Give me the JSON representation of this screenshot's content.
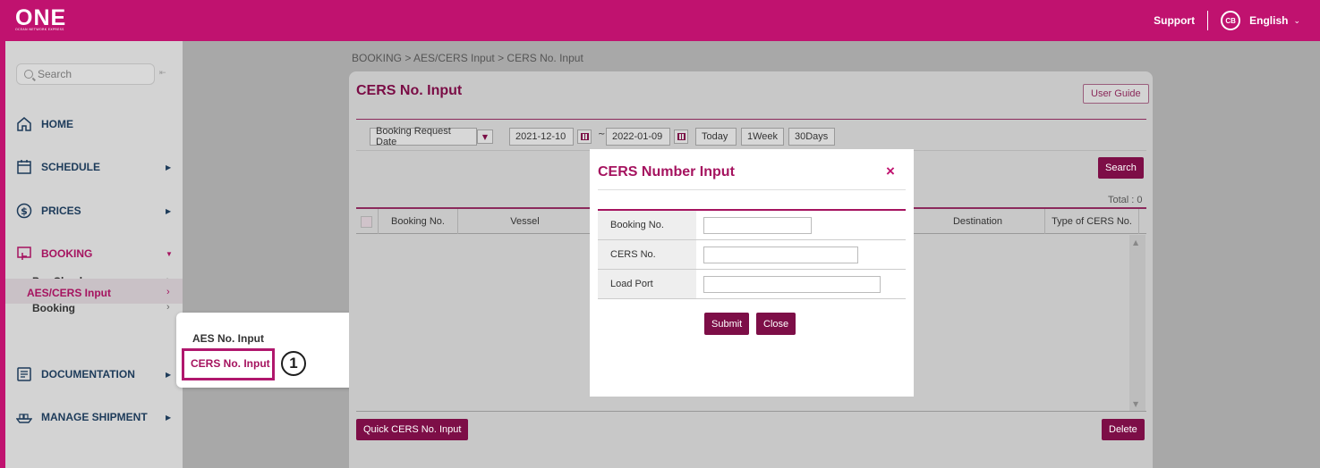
{
  "header": {
    "logo_text": "ONE",
    "logo_subtext": "OCEAN NETWORK EXPRESS",
    "support_label": "Support",
    "avatar_initials": "CB",
    "language_label": "English"
  },
  "sidebar": {
    "search_placeholder": "Search",
    "items": [
      {
        "label": "HOME",
        "icon": "home-icon"
      },
      {
        "label": "SCHEDULE",
        "icon": "calendar-icon"
      },
      {
        "label": "PRICES",
        "icon": "dollar-icon"
      },
      {
        "label": "BOOKING",
        "icon": "booking-icon"
      },
      {
        "label": "DOCUMENTATION",
        "icon": "document-icon"
      },
      {
        "label": "MANAGE SHIPMENT",
        "icon": "ship-icon"
      }
    ],
    "booking_sub": [
      {
        "label": "Pre-Check"
      },
      {
        "label": "Booking"
      },
      {
        "label": "AES/CERS Input"
      }
    ]
  },
  "flyout": {
    "items": [
      "AES No. Input",
      "CERS No. Input"
    ],
    "step_marker": "1"
  },
  "main": {
    "breadcrumb": "BOOKING > AES/CERS Input > CERS No. Input",
    "title": "CERS No. Input",
    "user_guide": "User Guide",
    "filter": {
      "date_type": "Booking Request Date",
      "from_date": "2021-12-10",
      "to_date": "2022-01-09",
      "tilde": "~",
      "today": "Today",
      "week": "1Week",
      "days30": "30Days"
    },
    "search_button": "Search",
    "total": "Total : 0",
    "columns": [
      "Booking No.",
      "Vessel",
      "Destination",
      "Type of CERS No."
    ],
    "quick_button": "Quick CERS No. Input",
    "delete_button": "Delete"
  },
  "modal": {
    "title": "CERS Number Input",
    "close_symbol": "×",
    "fields": [
      {
        "label": "Booking No.",
        "value": ""
      },
      {
        "label": "CERS No.",
        "value": ""
      },
      {
        "label": "Load Port",
        "value": ""
      }
    ],
    "submit": "Submit",
    "close": "Close"
  },
  "colors": {
    "brand": "#c0126f",
    "dark_brand": "#7d0e47",
    "overlay_gray": "#a8a8a8"
  }
}
